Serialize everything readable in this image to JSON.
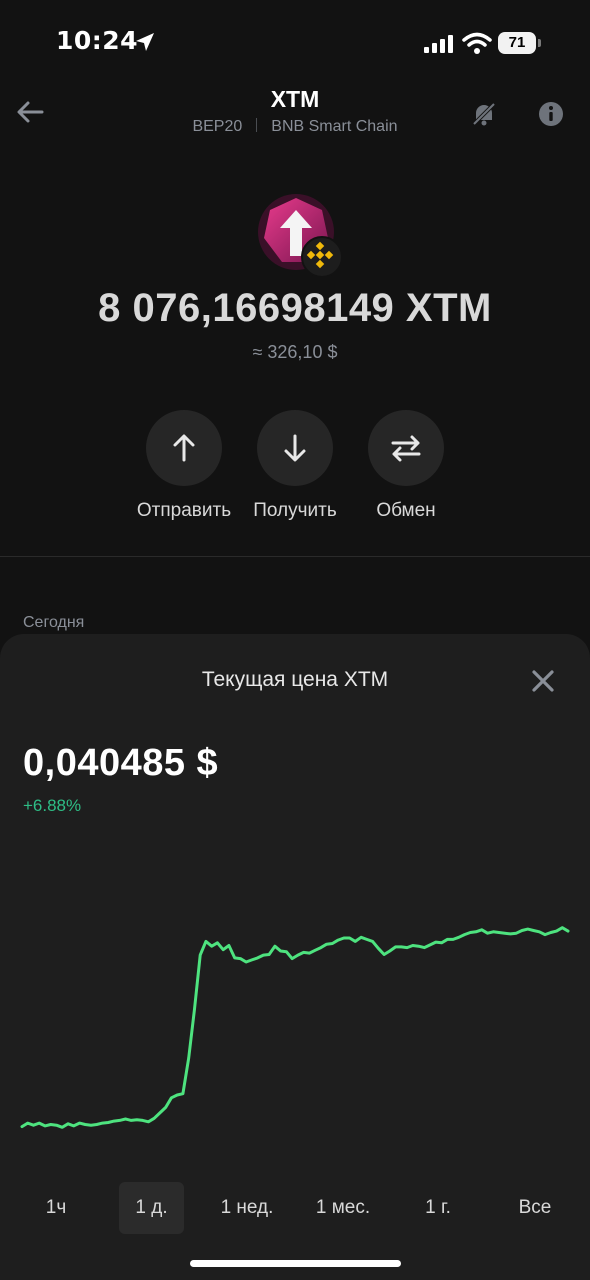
{
  "status_bar": {
    "time": "10:24",
    "battery": "71"
  },
  "header": {
    "title": "XTM",
    "network": "BEP20",
    "chain": "BNB Smart Chain"
  },
  "balance": {
    "amount": "8 076,16698149 XTM",
    "fiat": "≈ 326,10 $"
  },
  "actions": [
    {
      "label": "Отправить",
      "icon": "arrow-up-icon"
    },
    {
      "label": "Получить",
      "icon": "arrow-down-icon"
    },
    {
      "label": "Обмен",
      "icon": "swap-icon"
    }
  ],
  "history": {
    "section_label": "Сегодня"
  },
  "price_sheet": {
    "title": "Текущая цена XTM",
    "price": "0,040485 $",
    "change": "+6.88%",
    "colors": {
      "line": "#4ee37f",
      "positive": "#2ebd85"
    }
  },
  "chart_data": {
    "type": "line",
    "title": "",
    "xlabel": "",
    "ylabel": "",
    "grid": false,
    "legend": "none",
    "x": [
      0,
      1,
      2,
      3,
      4,
      5,
      6,
      7,
      8,
      9,
      10,
      11,
      12,
      13,
      14,
      15,
      16,
      17,
      18,
      19,
      20,
      21,
      22,
      23,
      24,
      25,
      26,
      27,
      28,
      29,
      30,
      31,
      32,
      33,
      34,
      35,
      36,
      37,
      38,
      39,
      40,
      41,
      42,
      43,
      44,
      45,
      46,
      47,
      48,
      49,
      50,
      51,
      52,
      53,
      54,
      55,
      56,
      57,
      58,
      59,
      60,
      61,
      62,
      63,
      64,
      65,
      66,
      67,
      68,
      69,
      70,
      71,
      72,
      73,
      74,
      75,
      76,
      77,
      78,
      79,
      80,
      81,
      82,
      83,
      84,
      85,
      86,
      87,
      88,
      89,
      90,
      91,
      92,
      93,
      94,
      95
    ],
    "values": [
      0.0379,
      0.03795,
      0.03792,
      0.03795,
      0.03791,
      0.03793,
      0.03792,
      0.03789,
      0.03794,
      0.03791,
      0.03795,
      0.03793,
      0.03792,
      0.03793,
      0.03795,
      0.03796,
      0.03798,
      0.03799,
      0.03801,
      0.03799,
      0.038,
      0.03799,
      0.03797,
      0.03802,
      0.0381,
      0.03818,
      0.03832,
      0.03836,
      0.03838,
      0.0389,
      0.0396,
      0.0404,
      0.0406,
      0.04053,
      0.04058,
      0.04048,
      0.04054,
      0.04036,
      0.04035,
      0.0403,
      0.04033,
      0.04036,
      0.0404,
      0.04041,
      0.04053,
      0.04046,
      0.04045,
      0.04035,
      0.0404,
      0.04044,
      0.04043,
      0.04047,
      0.04051,
      0.04056,
      0.04057,
      0.04062,
      0.04065,
      0.04065,
      0.0406,
      0.04066,
      0.04063,
      0.0406,
      0.0405,
      0.04041,
      0.04046,
      0.04052,
      0.04052,
      0.04051,
      0.04054,
      0.04053,
      0.04051,
      0.04055,
      0.04059,
      0.04058,
      0.04063,
      0.04063,
      0.04066,
      0.0407,
      0.04073,
      0.04074,
      0.04077,
      0.04072,
      0.04074,
      0.04073,
      0.04072,
      0.04071,
      0.04072,
      0.04076,
      0.04078,
      0.04076,
      0.04074,
      0.0407,
      0.04073,
      0.04075,
      0.0408,
      0.04075
    ],
    "ylim": [
      0.0375,
      0.041
    ]
  },
  "periods": [
    {
      "label": "1ч",
      "active": false
    },
    {
      "label": "1 д.",
      "active": true
    },
    {
      "label": "1 нед.",
      "active": false
    },
    {
      "label": "1 мес.",
      "active": false
    },
    {
      "label": "1 г.",
      "active": false
    },
    {
      "label": "Все",
      "active": false
    }
  ]
}
